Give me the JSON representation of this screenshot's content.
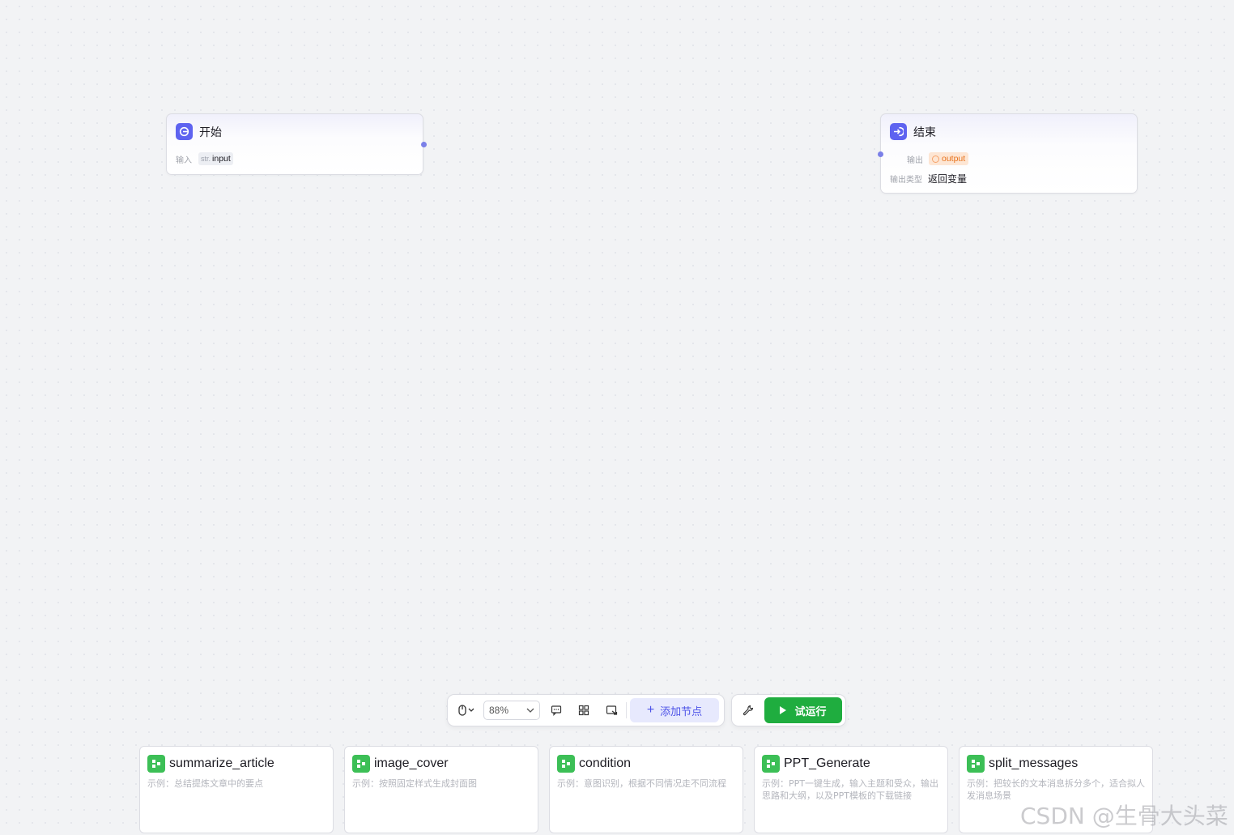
{
  "canvas": {
    "start_node": {
      "title": "开始",
      "input_label": "输入",
      "input_type": "str.",
      "input_name": "input"
    },
    "end_node": {
      "title": "结束",
      "output_label": "输出",
      "output_name": "output",
      "output_type_label": "输出类型",
      "output_type_value": "返回变量"
    }
  },
  "toolbar": {
    "zoom": "88%",
    "add_node_label": "添加节点",
    "run_label": "试运行"
  },
  "templates": [
    {
      "title": "summarize_article",
      "desc": "示例：总结提炼文章中的要点"
    },
    {
      "title": "image_cover",
      "desc": "示例：按照固定样式生成封面图"
    },
    {
      "title": "condition",
      "desc": "示例：意图识别，根据不同情况走不同流程"
    },
    {
      "title": "PPT_Generate",
      "desc": "示例：PPT一键生成，输入主题和受众，输出思路和大纲，以及PPT模板的下载链接"
    },
    {
      "title": "split_messages",
      "desc": "示例：把较长的文本消息拆分多个，适合拟人发消息场景"
    }
  ],
  "watermark": "CSDN @生骨大头菜",
  "colors": {
    "node_icon": "#5e63f0",
    "run_button": "#1fad3f",
    "template_icon": "#3cbf56",
    "output_tag": "#e8731d"
  }
}
